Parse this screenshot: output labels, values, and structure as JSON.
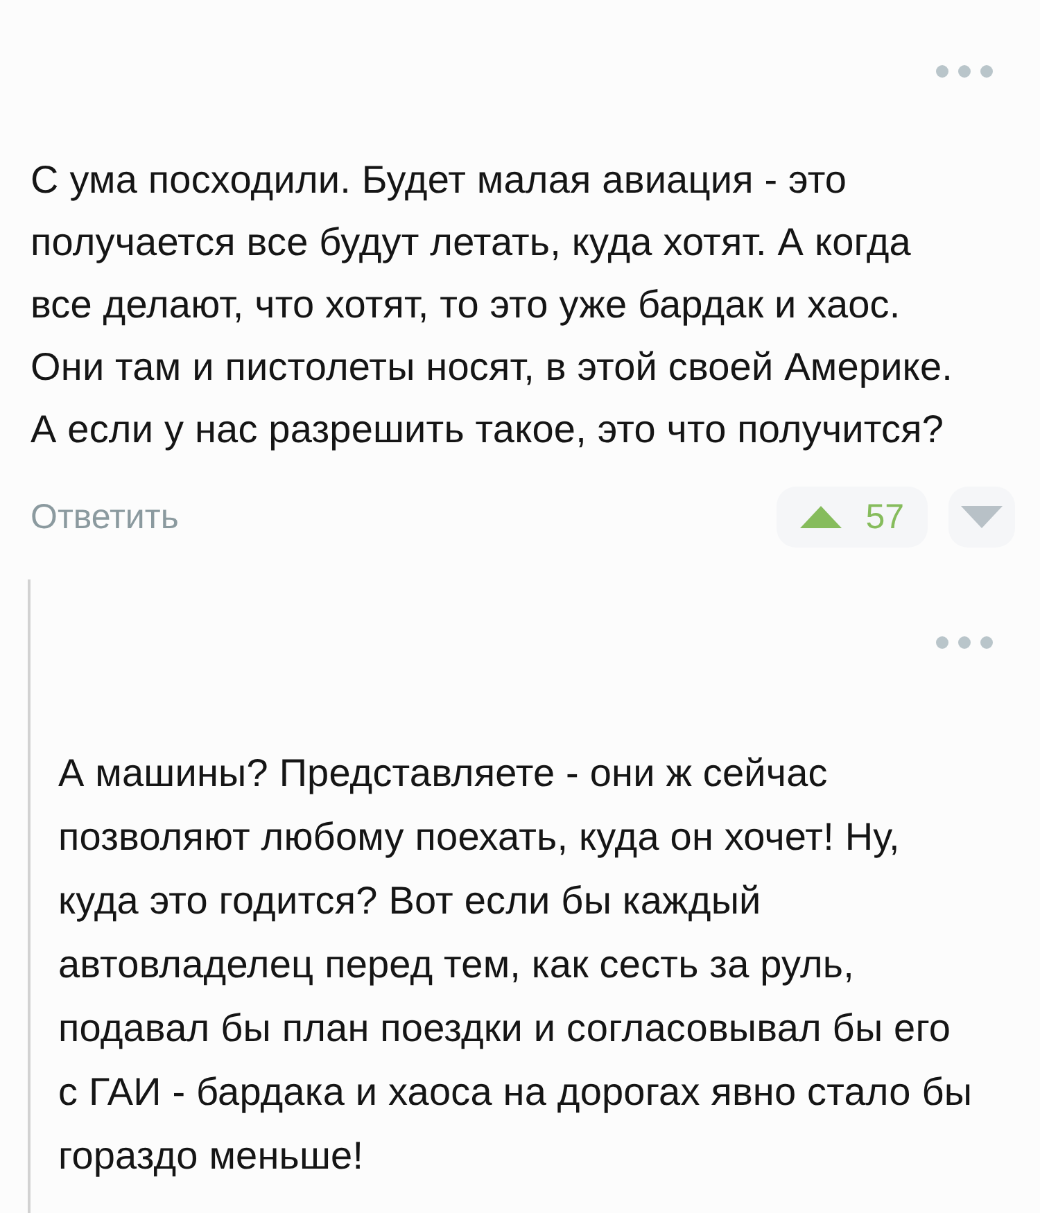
{
  "thread": [
    {
      "text": "С ума посходили. Будет малая авиация - это\nполучается все будут летать, куда хотят. А когда\nвсе делают, что хотят, то это уже бардак и хаос.\nОни там и пистолеты носят, в этой своей Америке.\nА если у нас разрешить такое, это что получится?",
      "reply_label": "Ответить",
      "rating": "57",
      "children": [
        {
          "text": "А машины? Представляете - они ж сейчас\nпозволяют любому поехать, куда он хочет! Ну,\nкуда это годится? Вот если бы каждый\nавтовладелец перед тем, как сесть за руль,\nподавал бы план поездки и согласовывал бы его\nс ГАИ - бардака и хаоса на дорогах явно стало бы\nгораздо меньше!"
        }
      ]
    }
  ]
}
